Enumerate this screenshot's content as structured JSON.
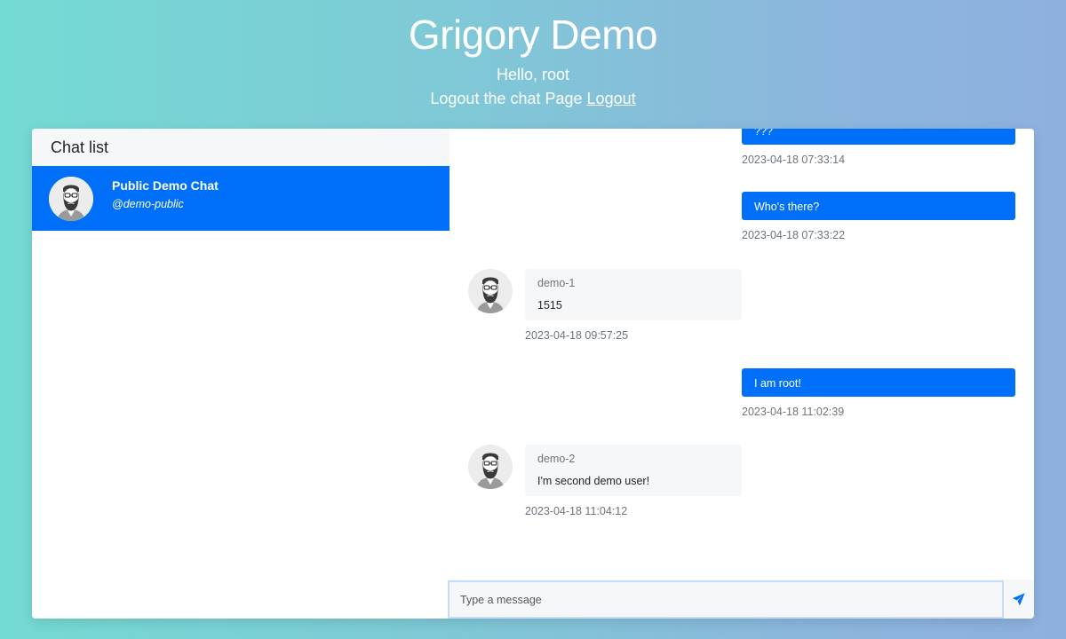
{
  "header": {
    "title": "Grigory Demo",
    "greeting": "Hello, root",
    "logout_text": "Logout the chat Page",
    "logout_link": "Logout"
  },
  "chat_list": {
    "title": "Chat list",
    "items": [
      {
        "name": "Public Demo Chat",
        "handle": "@demo-public",
        "avatar": "bearded-man-avatar",
        "active": true
      }
    ]
  },
  "messages": [
    {
      "direction": "outgoing",
      "text": "???",
      "time": "2023-04-18 07:33:14"
    },
    {
      "direction": "outgoing",
      "text": "Who's there?",
      "time": "2023-04-18 07:33:22"
    },
    {
      "direction": "incoming",
      "author": "demo-1",
      "text": "1515",
      "time": "2023-04-18 09:57:25",
      "avatar": "bearded-man-avatar"
    },
    {
      "direction": "outgoing",
      "text": "I am root!",
      "time": "2023-04-18 11:02:39"
    },
    {
      "direction": "incoming",
      "author": "demo-2",
      "text": "I'm second demo user!",
      "time": "2023-04-18 11:04:12",
      "avatar": "bearded-man-avatar"
    }
  ],
  "composer": {
    "placeholder": "Type a message",
    "value": "",
    "send_icon": "send-icon"
  },
  "colors": {
    "accent": "#0070fa",
    "bubble_incoming": "#f6f7f9",
    "gradient_start": "#74dbd3",
    "gradient_end": "#8fb0df"
  }
}
